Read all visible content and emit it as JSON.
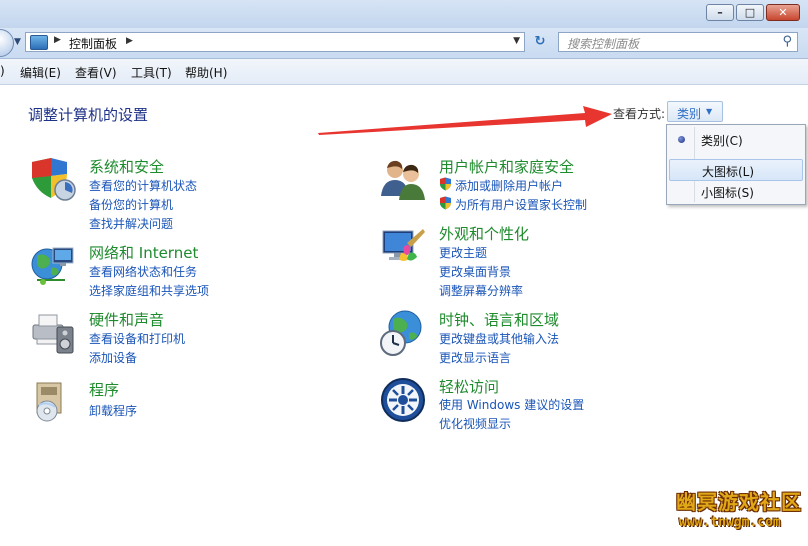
{
  "address": {
    "crumb": "控制面板",
    "search_placeholder": "搜索控制面板"
  },
  "menubar": [
    "编辑(E)",
    "查看(V)",
    "工具(T)",
    "帮助(H)"
  ],
  "first_menu_partial": ")",
  "page_title": "调整计算机的设置",
  "view": {
    "label": "查看方式:",
    "button": "类别",
    "options": [
      {
        "text": "类别(C)",
        "selected": true
      },
      {
        "text": "大图标(L)",
        "selected": false,
        "highlighted": true
      },
      {
        "text": "小图标(S)",
        "selected": false
      }
    ]
  },
  "categories_left": [
    {
      "title": "系统和安全",
      "icon": "system-security-icon",
      "links": [
        "查看您的计算机状态",
        "备份您的计算机",
        "查找并解决问题"
      ]
    },
    {
      "title": "网络和 Internet",
      "icon": "network-icon",
      "links": [
        "查看网络状态和任务",
        "选择家庭组和共享选项"
      ]
    },
    {
      "title": "硬件和声音",
      "icon": "hardware-sound-icon",
      "links": [
        "查看设备和打印机",
        "添加设备"
      ]
    },
    {
      "title": "程序",
      "icon": "programs-icon",
      "links": [
        "卸载程序"
      ]
    }
  ],
  "categories_right": [
    {
      "title": "用户帐户和家庭安全",
      "icon": "user-accounts-icon",
      "links": [
        "添加或删除用户帐户",
        "为所有用户设置家长控制"
      ]
    },
    {
      "title": "外观和个性化",
      "icon": "appearance-icon",
      "links": [
        "更改主题",
        "更改桌面背景",
        "调整屏幕分辨率"
      ]
    },
    {
      "title": "时钟、语言和区域",
      "icon": "clock-language-icon",
      "links": [
        "更改键盘或其他输入法",
        "更改显示语言"
      ]
    },
    {
      "title": "轻松访问",
      "icon": "ease-of-access-icon",
      "links": [
        "使用 Windows 建议的设置",
        "优化视频显示"
      ]
    }
  ],
  "watermark": {
    "name": "幽冥游戏社区",
    "url": "www.tnwgm.com"
  },
  "colors": {
    "category_title": "#1e8b2d",
    "link": "#1a55b8",
    "page_title": "#1e3287",
    "arrow": "#e8352f"
  }
}
